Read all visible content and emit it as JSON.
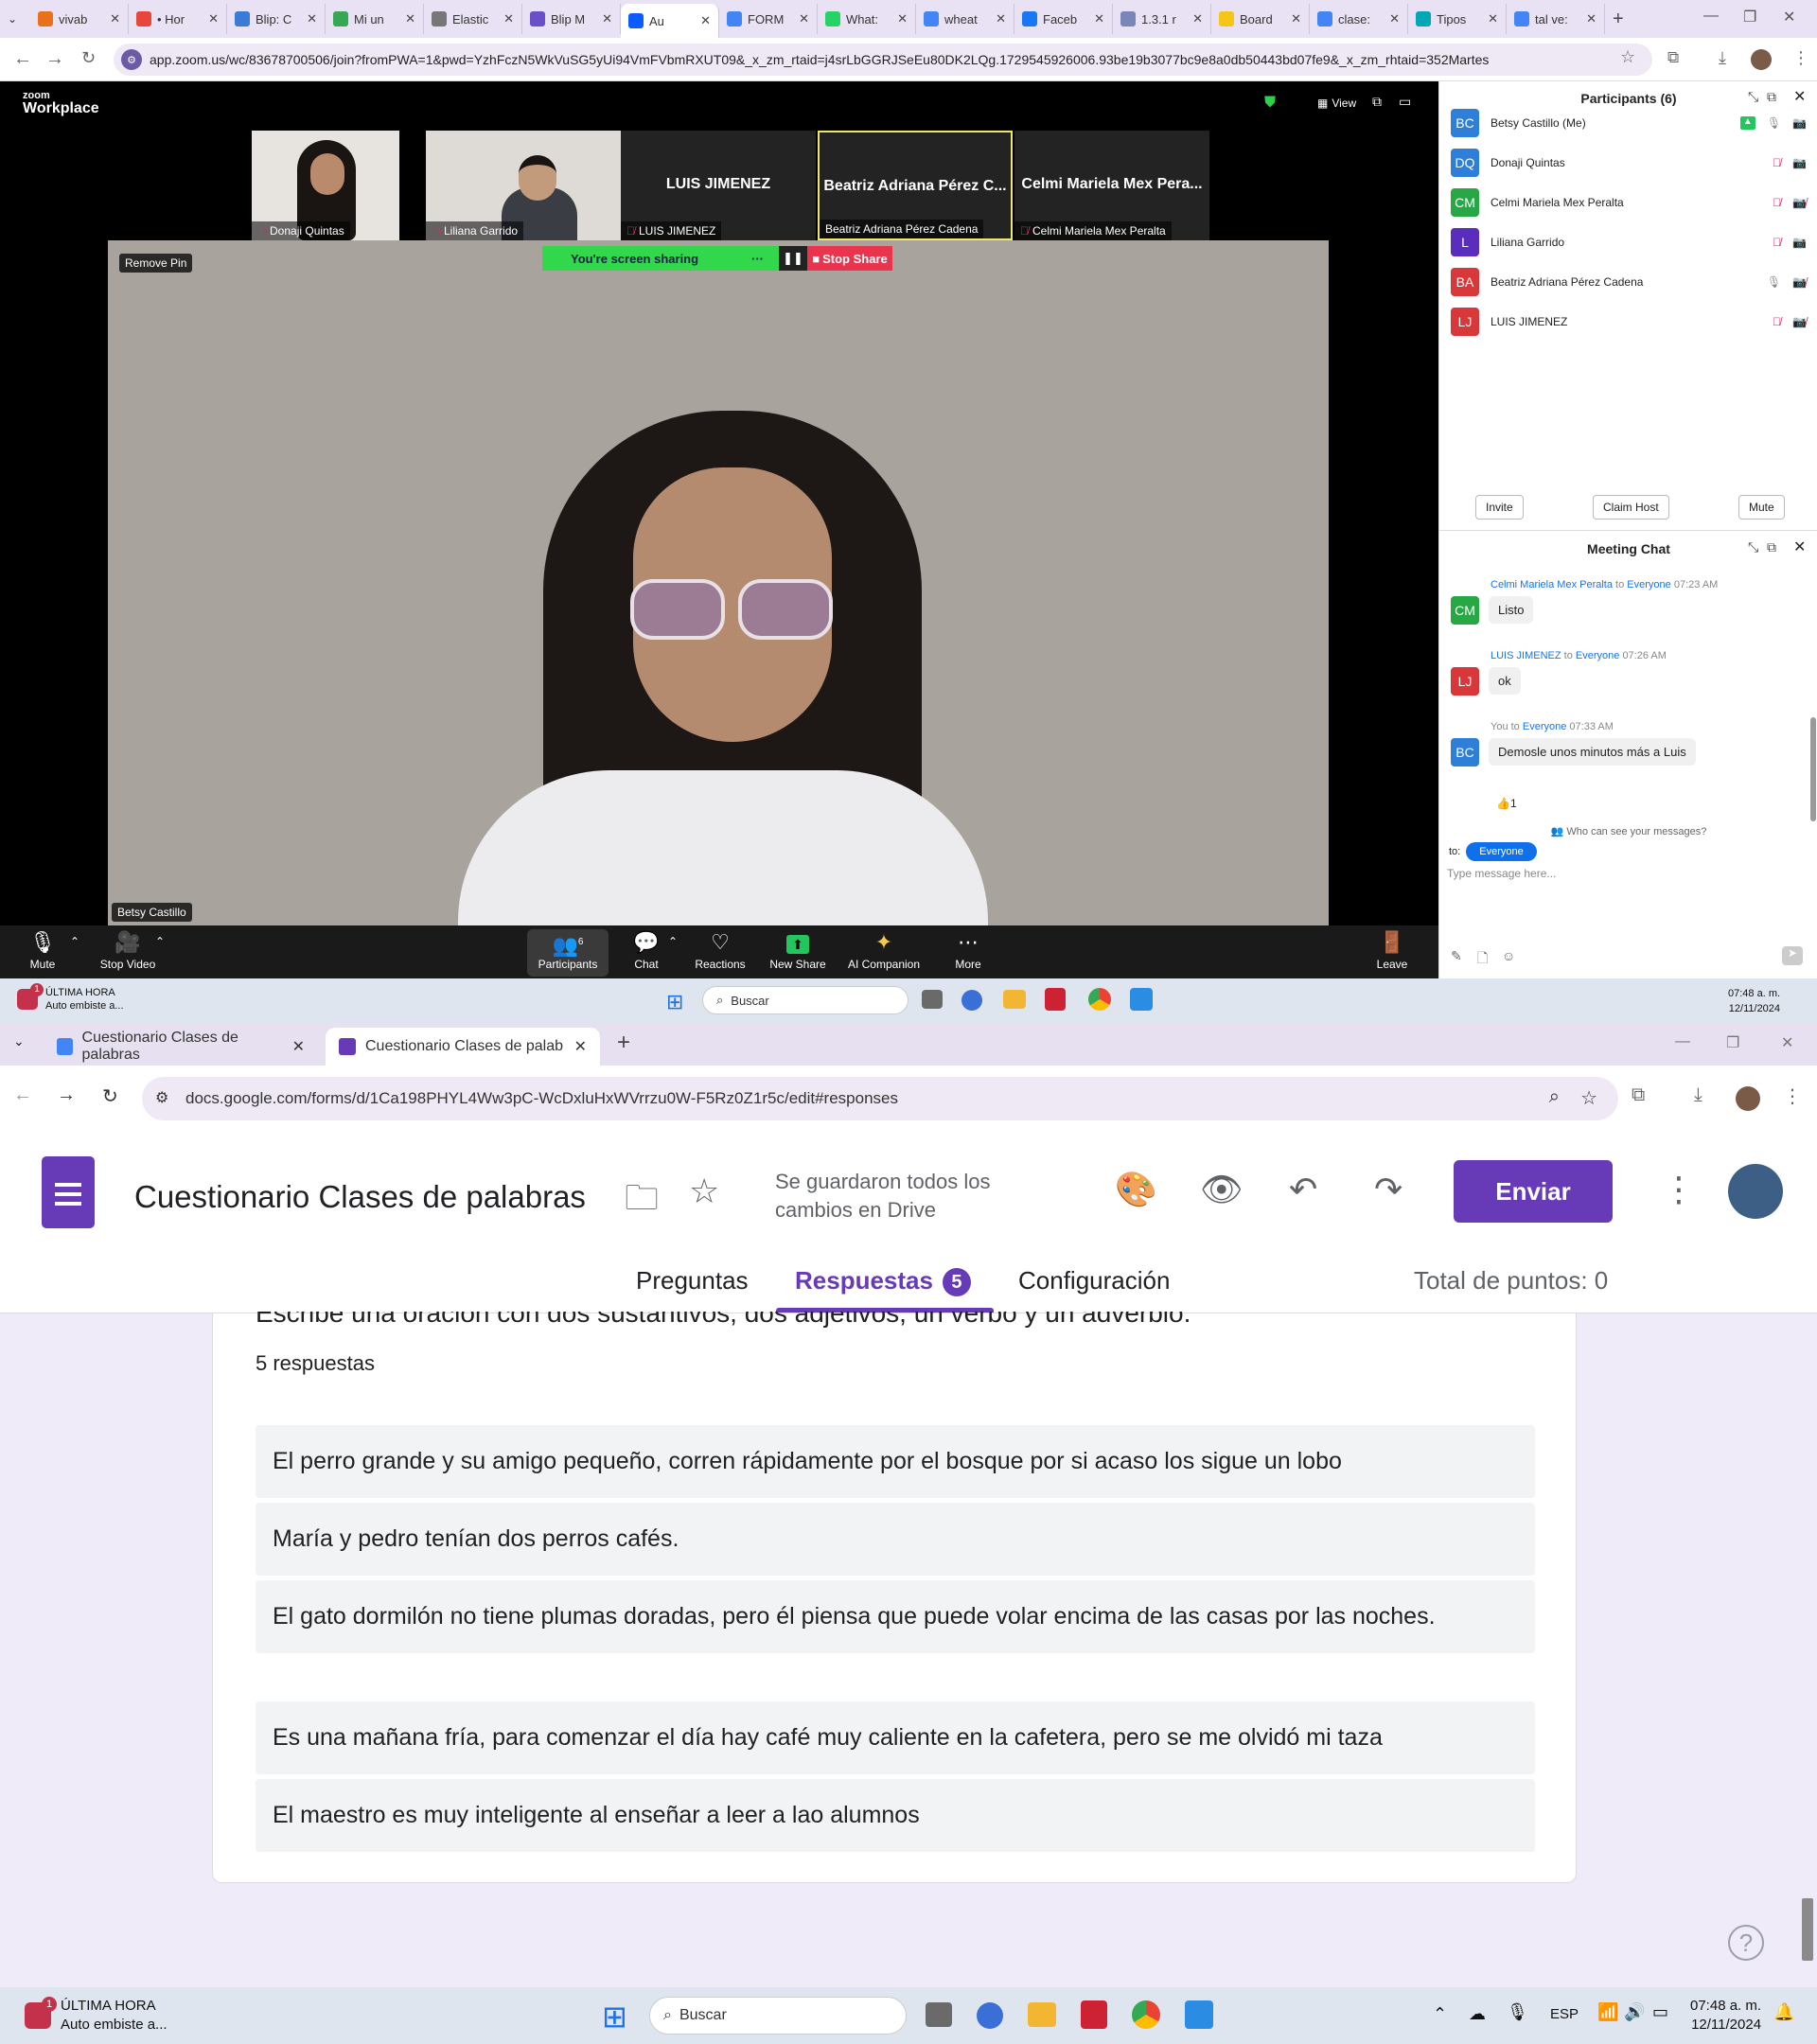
{
  "top_browser": {
    "tabs": [
      {
        "label": "vivab",
        "color": "#e8711a"
      },
      {
        "label": "• Hor",
        "color": "#e8453c"
      },
      {
        "label": "Blip: C",
        "color": "#3a7bd5"
      },
      {
        "label": "Mi un",
        "color": "#34a853"
      },
      {
        "label": "Elastic",
        "color": "#777777"
      },
      {
        "label": "Blip M",
        "color": "#6a4fc9"
      },
      {
        "label": "Au",
        "color": "#0b5cff"
      },
      {
        "label": "FORM",
        "color": "#4285f4"
      },
      {
        "label": "What:",
        "color": "#25d366"
      },
      {
        "label": "wheat",
        "color": "#4285f4"
      },
      {
        "label": "Faceb",
        "color": "#1877f2"
      },
      {
        "label": "1.3.1 r",
        "color": "#7a86b8"
      },
      {
        "label": "Board",
        "color": "#f5c518"
      },
      {
        "label": "clase:",
        "color": "#4285f4"
      },
      {
        "label": "Tipos",
        "color": "#00a7b5"
      },
      {
        "label": "tal ve:",
        "color": "#4285f4"
      }
    ],
    "url": "app.zoom.us/wc/83678700506/join?fromPWA=1&pwd=YzhFczN5WkVuSG5yUi94VmFVbmRXUT09&_x_zm_rtaid=j4srLbGGRJSeEu80DK2LQg.1729545926006.93be19b3077bc9e8a0db50443bd07fe9&_x_zm_rhtaid=352Martes"
  },
  "zoom": {
    "logo_small": "zoom",
    "logo_big": "Workplace",
    "view_label": "View",
    "thumbnails": [
      {
        "name": "Donaji Quintas",
        "title": ""
      },
      {
        "name": "Liliana Garrido",
        "title": ""
      },
      {
        "name": "LUIS JIMENEZ",
        "title": "LUIS JIMENEZ"
      },
      {
        "name": "Beatriz Adriana Pérez Cadena",
        "title": "Beatriz Adriana Pérez C..."
      },
      {
        "name": "Celmi Mariela Mex Peralta",
        "title": "Celmi Mariela Mex Pera..."
      }
    ],
    "remove_pin": "Remove Pin",
    "sharing": "You're screen sharing",
    "stop_share": "Stop Share",
    "main_name": "Betsy Castillo",
    "toolbar": {
      "mute": "Mute",
      "stop_video": "Stop Video",
      "participants": "Participants",
      "participants_count": "6",
      "chat": "Chat",
      "reactions": "Reactions",
      "new_share": "New Share",
      "ai_companion": "AI Companion",
      "more": "More",
      "leave": "Leave"
    }
  },
  "participants_panel": {
    "title": "Participants (6)",
    "people": [
      {
        "initials": "BC",
        "name": "Betsy Castillo (Me)",
        "color": "#2d7fd8"
      },
      {
        "initials": "DQ",
        "name": "Donaji Quintas",
        "color": "#2d7fd8"
      },
      {
        "initials": "CM",
        "name": "Celmi Mariela Mex Peralta",
        "color": "#28a745"
      },
      {
        "initials": "L",
        "name": "Liliana Garrido",
        "color": "#5b2dbd"
      },
      {
        "initials": "BA",
        "name": "Beatriz Adriana Pérez Cadena",
        "color": "#d9383a"
      },
      {
        "initials": "LJ",
        "name": "LUIS JIMENEZ",
        "color": "#d9383a"
      }
    ],
    "invite": "Invite",
    "claim_host": "Claim Host",
    "mute": "Mute"
  },
  "chat": {
    "title": "Meeting Chat",
    "messages": [
      {
        "sender": "Celmi Mariela Mex Peralta",
        "to": "to",
        "audience": "Everyone",
        "time": "07:23 AM",
        "text": "Listo",
        "initials": "CM",
        "color": "#28a745"
      },
      {
        "sender": "LUIS JIMENEZ",
        "to": "to",
        "audience": "Everyone",
        "time": "07:26 AM",
        "text": "ok",
        "initials": "LJ",
        "color": "#d9383a"
      },
      {
        "sender": "You",
        "to": "to",
        "audience": "Everyone",
        "time": "07:33 AM",
        "text": "Demosle unos minutos más a Luis",
        "initials": "BC",
        "color": "#2d7fd8"
      }
    ],
    "reaction": "👍1",
    "who_can_see": "Who can see your messages?",
    "to_label": "to:",
    "to_value": "Everyone",
    "placeholder": "Type message here..."
  },
  "taskbar_top": {
    "news_title": "ÚLTIMA HORA",
    "news_sub": "Auto embiste a...",
    "news_badge": "1",
    "search": "Buscar",
    "time": "07:48 a. m.",
    "date": "12/11/2024"
  },
  "bottom_browser": {
    "tabs": [
      {
        "label": "Cuestionario Clases de palabras"
      },
      {
        "label": "Cuestionario Clases de palabras"
      }
    ],
    "url": "docs.google.com/forms/d/1Ca198PHYL4Ww3pC-WcDxluHxWVrrzu0W-F5Rz0Z1r5c/edit#responses"
  },
  "form": {
    "title": "Cuestionario Clases de palabras",
    "saved": "Se guardaron todos los cambios en Drive",
    "send": "Enviar",
    "tabs": {
      "questions": "Preguntas",
      "responses": "Respuestas",
      "responses_count": "5",
      "settings": "Configuración"
    },
    "total_points": "Total de puntos: 0",
    "question": "Escribe una oración con dos sustantivos, dos adjetivos, un verbo y un adverbio.",
    "count": "5 respuestas",
    "responses": [
      "El perro grande y su amigo pequeño, corren rápidamente por el bosque por si acaso los sigue un lobo",
      "María y pedro tenían dos perros cafés.",
      "El gato dormilón no tiene plumas doradas, pero él piensa que puede volar encima de las casas por las noches.",
      "Es una mañana fría, para comenzar el día hay café muy caliente en la cafetera, pero se me olvidó mi taza",
      "El maestro es muy inteligente al enseñar a leer a lao alumnos"
    ]
  },
  "taskbar_bottom": {
    "news_title": "ÚLTIMA HORA",
    "news_sub": "Auto embiste a...",
    "news_badge": "1",
    "search": "Buscar",
    "lang": "ESP",
    "time": "07:48 a. m.",
    "date": "12/11/2024"
  }
}
